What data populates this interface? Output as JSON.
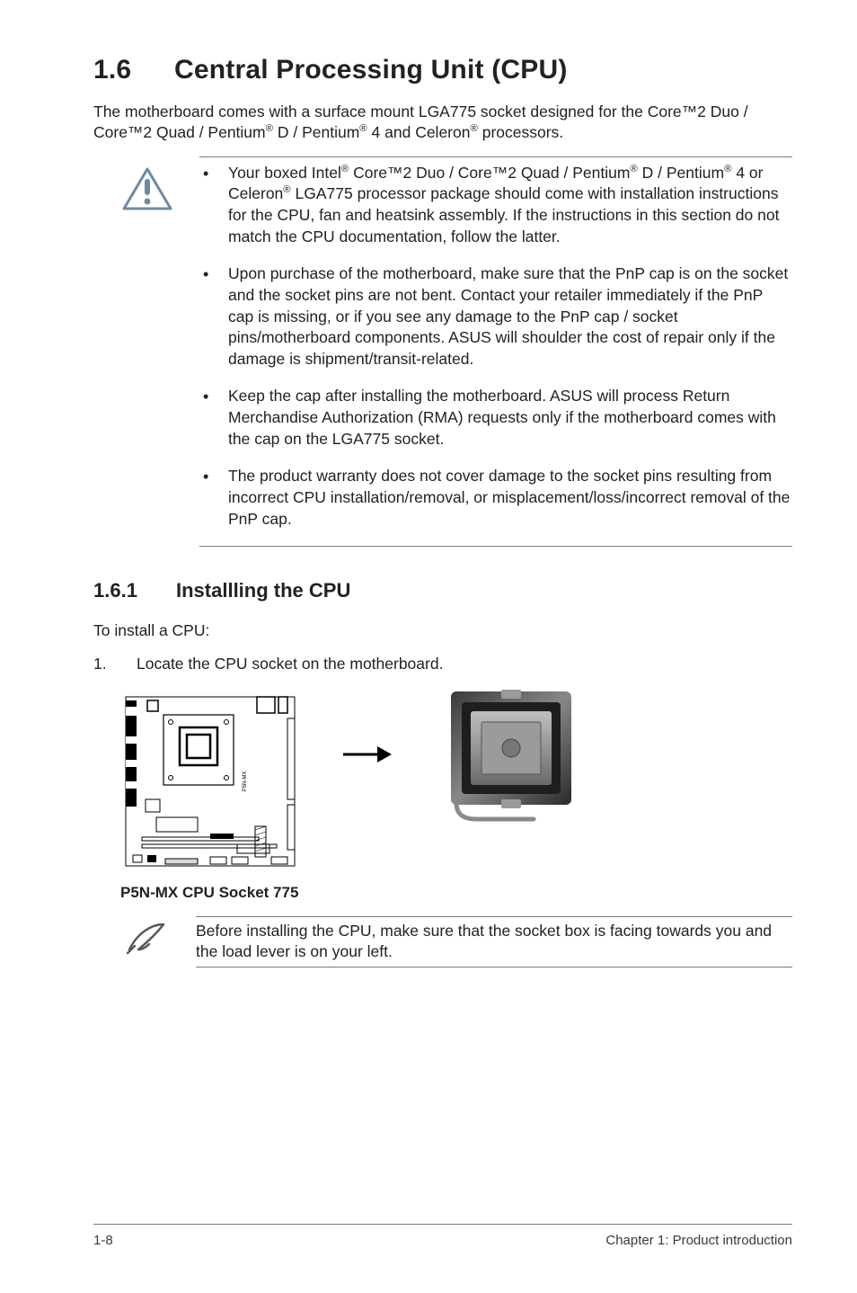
{
  "heading": {
    "num": "1.6",
    "title": "Central Processing Unit (CPU)"
  },
  "intro_html": "The motherboard comes with a surface mount LGA775 socket designed for the Core™2 Duo / Core™2 Quad / Pentium<sup>®</sup> D / Pentium<sup>®</sup> 4 and Celeron<sup>®</sup> processors.",
  "caution_bullets_html": [
    "Your boxed Intel<sup>®</sup> Core™2 Duo / Core™2 Quad / Pentium<sup>®</sup> D / Pentium<sup>®</sup> 4 or Celeron<sup>®</sup> LGA775 processor package should come with installation instructions for the CPU, fan and heatsink assembly. If the instructions in this section do not match the CPU documentation, follow the latter.",
    "Upon purchase of the motherboard, make sure that the PnP cap is on the socket and the socket pins are not bent. Contact your retailer immediately if the PnP cap is missing, or if you see any damage to the PnP cap / socket pins/motherboard components. ASUS will shoulder the cost of repair only if the damage is shipment/transit-related.",
    "Keep the cap after installing the motherboard. ASUS will process Return Merchandise Authorization (RMA) requests only if the motherboard comes with the cap on the LGA775 socket.",
    "The product warranty does not cover damage to the socket pins resulting from incorrect CPU installation/removal, or misplacement/loss/incorrect removal of the PnP cap."
  ],
  "subheading": {
    "num": "1.6.1",
    "title": "Installling the CPU"
  },
  "lead": "To install a CPU:",
  "step1": {
    "num": "1.",
    "text": "Locate the CPU socket on the motherboard."
  },
  "diagram_caption": "P5N-MX CPU Socket 775",
  "mobo_label": "P5N-MX",
  "note_text": "Before installing the CPU, make sure that the socket box is facing towards you and the load lever is on your left.",
  "footer": {
    "left": "1-8",
    "right": "Chapter 1: Product introduction"
  }
}
